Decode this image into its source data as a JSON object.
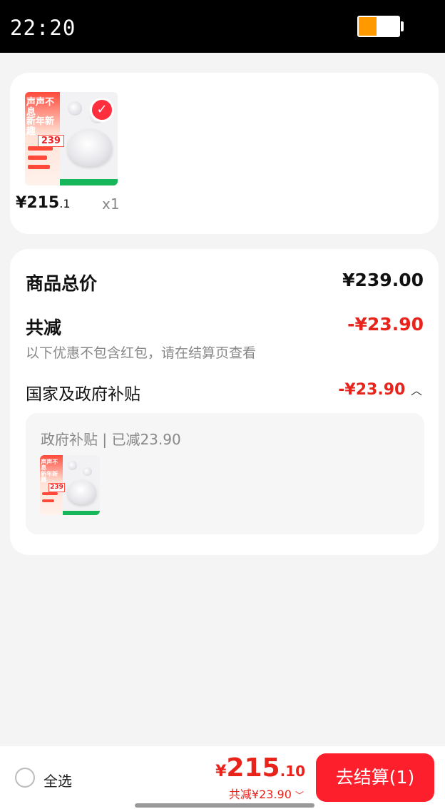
{
  "status_bar": {
    "time": "22:20",
    "battery_level": 0.45
  },
  "product": {
    "price_symbol": "¥",
    "price_int": "215",
    "price_dec": ".1",
    "quantity": "x1",
    "thumbnail": {
      "promo_title": "声声不息\n新年新趣",
      "price_tag": "239",
      "selected_icon": "check-icon"
    }
  },
  "summary": {
    "total_label": "商品总价",
    "total_value": "¥239.00",
    "reduce_label": "共减",
    "reduce_value": "-¥23.90",
    "reduce_hint": "以下优惠不包含红包，请在结算页查看",
    "subsidy_label": "国家及政府补贴",
    "subsidy_value": "-¥23.90",
    "subsidy_toggle_icon": "chevron-up-icon",
    "subsidy_detail_title": "政府补贴 | 已减23.90"
  },
  "footer": {
    "select_all_label": "全选",
    "total_currency": "¥",
    "total_int": "215",
    "total_dec": ".10",
    "total_discount": "共减¥23.90",
    "discount_toggle_icon": "chevron-down-icon",
    "checkout_label": "去结算(1)"
  },
  "colors": {
    "accent_red": "#e8231b",
    "button_red": "#fe1f2c",
    "battery_orange": "#ff9900"
  }
}
